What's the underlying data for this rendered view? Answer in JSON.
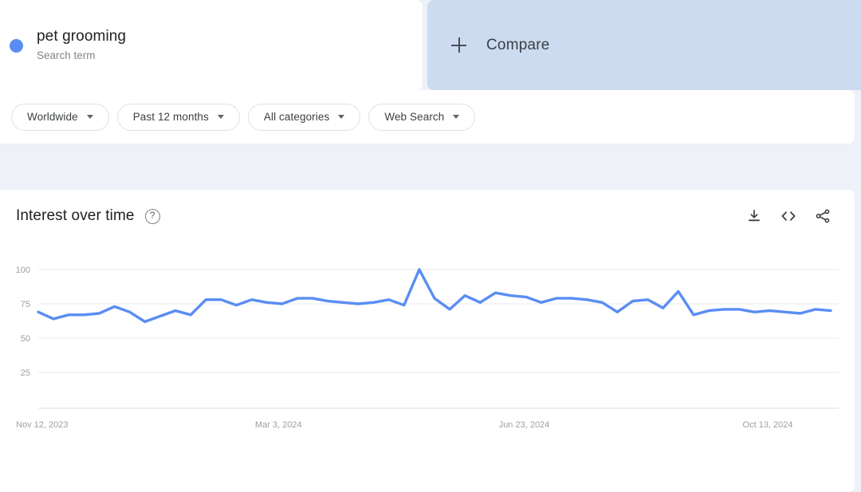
{
  "search_term": {
    "title": "pet grooming",
    "subtitle": "Search term",
    "dot_color": "#5a8df4"
  },
  "compare": {
    "label": "Compare",
    "icon": "plus-icon",
    "background": "#ccdbf0"
  },
  "filters": [
    {
      "label": "Worldwide",
      "name": "location-filter"
    },
    {
      "label": "Past 12 months",
      "name": "time-range-filter"
    },
    {
      "label": "All categories",
      "name": "category-filter"
    },
    {
      "label": "Web Search",
      "name": "search-type-filter"
    }
  ],
  "chart_panel": {
    "title": "Interest over time",
    "help_icon": "?",
    "actions": [
      {
        "name": "download-icon",
        "label": "Download CSV"
      },
      {
        "name": "embed-code-icon",
        "label": "Embed"
      },
      {
        "name": "share-icon",
        "label": "Share"
      }
    ]
  },
  "chart_data": {
    "type": "line",
    "title": "Interest over time",
    "xlabel": "",
    "ylabel": "",
    "ylim": [
      0,
      100
    ],
    "yticks": [
      100,
      75,
      50,
      25
    ],
    "grid": true,
    "legend_position": "none",
    "line_color": "#5a8df4",
    "x_tick_labels": [
      "Nov 12, 2023",
      "Mar 3, 2024",
      "Jun 23, 2024",
      "Oct 13, 2024"
    ],
    "x_tick_indices": [
      0,
      16,
      32,
      48
    ],
    "series": [
      {
        "name": "pet grooming",
        "color": "#5a8df4",
        "values": [
          69,
          64,
          67,
          67,
          68,
          73,
          69,
          62,
          66,
          70,
          67,
          78,
          78,
          74,
          78,
          76,
          75,
          79,
          79,
          77,
          76,
          75,
          76,
          78,
          74,
          100,
          79,
          71,
          81,
          76,
          83,
          81,
          80,
          76,
          79,
          79,
          78,
          76,
          69,
          77,
          78,
          72,
          84,
          67,
          70,
          71,
          71,
          69,
          70,
          69,
          68,
          71,
          70
        ]
      }
    ],
    "dates": [
      "Nov 12, 2023",
      "Nov 19, 2023",
      "Nov 26, 2023",
      "Dec 3, 2023",
      "Dec 10, 2023",
      "Dec 17, 2023",
      "Dec 24, 2023",
      "Dec 31, 2023",
      "Jan 7, 2024",
      "Jan 14, 2024",
      "Jan 21, 2024",
      "Jan 28, 2024",
      "Feb 4, 2024",
      "Feb 11, 2024",
      "Feb 18, 2024",
      "Feb 25, 2024",
      "Mar 3, 2024",
      "Mar 10, 2024",
      "Mar 17, 2024",
      "Mar 24, 2024",
      "Mar 31, 2024",
      "Apr 7, 2024",
      "Apr 14, 2024",
      "Apr 21, 2024",
      "Apr 28, 2024",
      "May 5, 2024",
      "May 12, 2024",
      "May 19, 2024",
      "May 26, 2024",
      "Jun 2, 2024",
      "Jun 9, 2024",
      "Jun 16, 2024",
      "Jun 23, 2024",
      "Jun 30, 2024",
      "Jul 7, 2024",
      "Jul 14, 2024",
      "Jul 21, 2024",
      "Jul 28, 2024",
      "Aug 4, 2024",
      "Aug 11, 2024",
      "Aug 18, 2024",
      "Aug 25, 2024",
      "Sep 1, 2024",
      "Sep 8, 2024",
      "Sep 15, 2024",
      "Sep 22, 2024",
      "Sep 29, 2024",
      "Oct 6, 2024",
      "Oct 13, 2024",
      "Oct 20, 2024",
      "Oct 27, 2024",
      "Nov 3, 2024",
      "Nov 10, 2024"
    ]
  }
}
